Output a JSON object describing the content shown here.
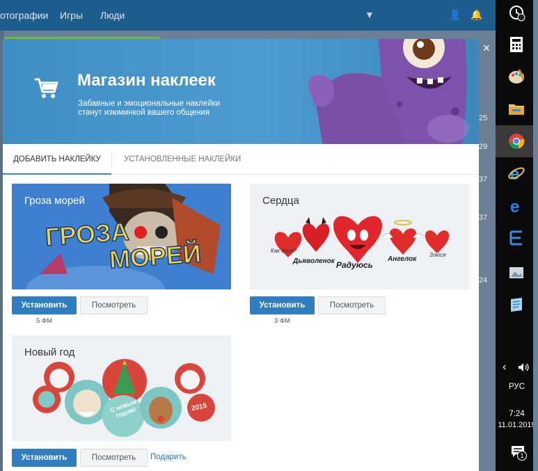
{
  "background_page": {
    "nav": [
      "отографии",
      "Игры",
      "Люди"
    ],
    "side_numbers": [
      "25",
      "29",
      "37",
      "37",
      "24"
    ]
  },
  "modal": {
    "title": "Магазин наклеек",
    "subtitle": "Забавные и эмоциональные наклейки станут изюминкой вашего общения",
    "close_label": "×",
    "tabs": [
      {
        "label": "ДОБАВИТЬ НАКЛЕЙКУ",
        "active": true
      },
      {
        "label": "УСТАНОВЛЕННЫЕ НАКЛЕЙКИ",
        "active": false
      }
    ],
    "install_label": "Установить",
    "view_label": "Посмотреть",
    "gift_label": "Подарить",
    "stickers": [
      {
        "title": "Гроза морей",
        "art_text": [
          "ГРОЗА",
          "МОРЕЙ"
        ],
        "price": "5 ФМ"
      },
      {
        "title": "Сердца",
        "art_labels": [
          "Как дела?",
          "Дьяволенок",
          "Радуюсь",
          "Ангелок",
          "Злюся"
        ],
        "price": "3 ФМ"
      },
      {
        "title": "Новый год",
        "art_labels": [
          "С новым годом!",
          "2015"
        ]
      }
    ]
  },
  "taskbar": {
    "language": "РУС",
    "time": "7:24",
    "date": "11.01.2019",
    "notification_count": "1"
  },
  "colors": {
    "accent": "#2f7fc0",
    "header": "#4d9bd0",
    "taskbar": "#0a0a0a"
  }
}
